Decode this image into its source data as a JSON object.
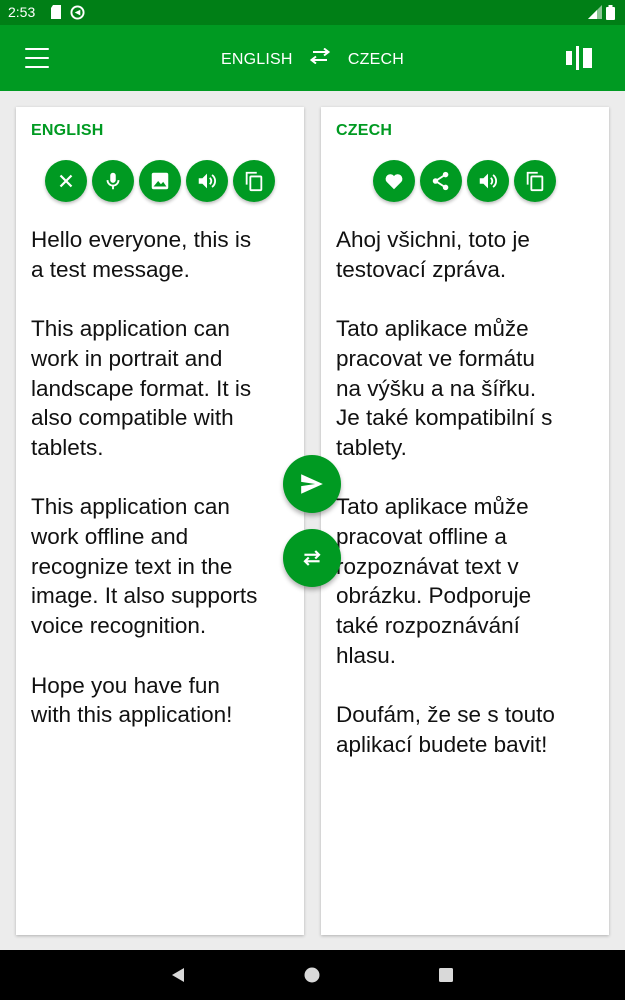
{
  "status_bar": {
    "time": "2:53",
    "icons": [
      "sd-card-icon",
      "sync-icon",
      "signal-icon",
      "battery-icon"
    ]
  },
  "toolbar": {
    "source_language": "ENGLISH",
    "target_language": "CZECH",
    "icons": [
      "menu-icon",
      "swap-languages-icon",
      "layout-toggle-icon"
    ]
  },
  "source_panel": {
    "title": "ENGLISH",
    "actions": [
      "clear-icon",
      "microphone-icon",
      "image-icon",
      "speaker-icon",
      "copy-icon"
    ],
    "text": "Hello everyone, this is\na test message.\n\nThis application can\nwork in portrait and\nlandscape format. It is\nalso compatible with\ntablets.\n\nThis application can\nwork offline and\nrecognize text in the\nimage. It also supports\nvoice recognition.\n\nHope you have fun\nwith this application!"
  },
  "target_panel": {
    "title": "CZECH",
    "actions": [
      "heart-icon",
      "share-icon",
      "speaker-icon",
      "copy-icon"
    ],
    "text": "Ahoj všichni, toto je\ntestovací zpráva.\n\nTato aplikace může\npracovat ve formátu\nna výšku a na šířku.\nJe také kompatibilní s\ntablety.\n\nTato aplikace může\npracovat offline a\nrozpoznávat text v\nobrázku. Podporuje\ntaké rozpoznávání\nhlasu.\n\nDoufám, že se s touto\naplikací budete bavit!"
  },
  "floating_buttons": [
    "send-icon",
    "swap-icon"
  ],
  "nav_bar": [
    "back-icon",
    "home-icon",
    "recents-icon"
  ],
  "colors": {
    "primary": "#009a22",
    "status_bar": "#007f16",
    "background": "#ececec",
    "card": "#ffffff",
    "text": "#111111"
  }
}
